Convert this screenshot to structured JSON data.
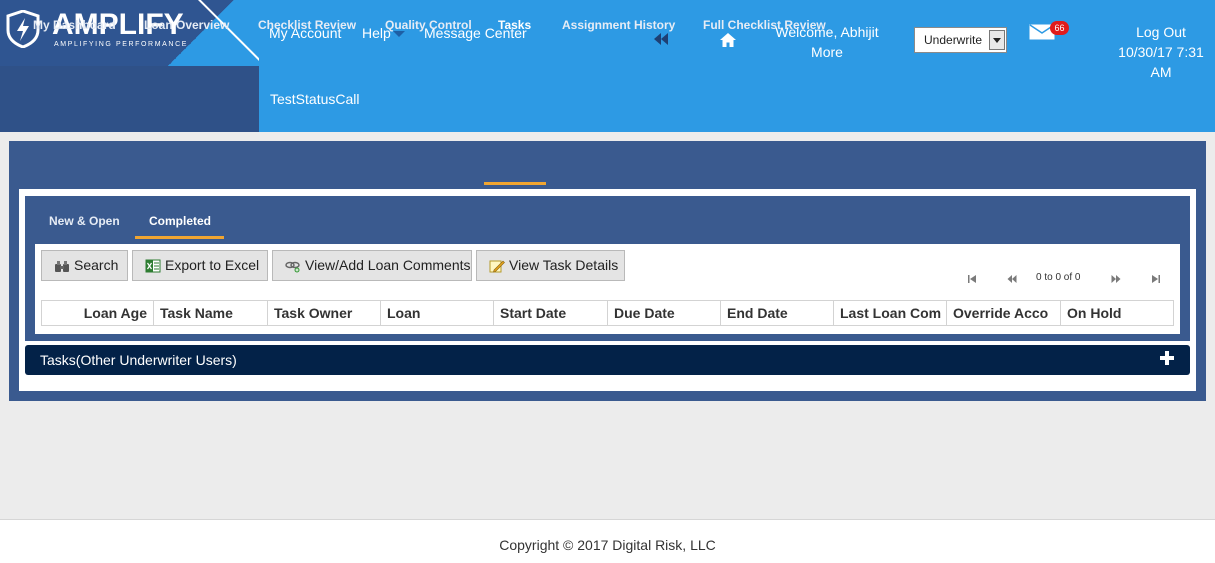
{
  "brand": {
    "name": "AMPLIFY",
    "tagline": "AMPLIFYING PERFORMANCE",
    "colors": {
      "header": "#2d9ae4",
      "logo_panel": "#2f5188",
      "content_panel": "#3a5a8f",
      "accent_underline": "#f0a531",
      "section_bar": "#032248",
      "badge": "#e11b1b"
    }
  },
  "header": {
    "links": {
      "my_account": "My Account",
      "help": "Help",
      "message_center": "Message Center",
      "status_call": "TestStatusCall"
    },
    "welcome_line1": "Welcome, Abhijit",
    "welcome_line2": "More",
    "role_select": {
      "selected": "Underwrite"
    },
    "mail_badge_count": "66",
    "logout": "Log Out",
    "datetime": "10/30/17 7:31 AM",
    "icons": [
      "shield-logo-icon",
      "caret-down-icon",
      "rewind-icon",
      "home-icon",
      "mail-icon"
    ]
  },
  "main_tabs": [
    {
      "label": "My Dashboard",
      "active": false
    },
    {
      "label": "Loan Overview",
      "active": false
    },
    {
      "label": "Checklist Review",
      "active": false
    },
    {
      "label": "Quality Control",
      "active": false
    },
    {
      "label": "Tasks",
      "active": true
    },
    {
      "label": "Assignment History",
      "active": false
    },
    {
      "label": "Full Checklist Review",
      "active": false
    }
  ],
  "sub_tabs": [
    {
      "label": "New & Open",
      "active": false
    },
    {
      "label": "Completed",
      "active": true
    }
  ],
  "toolbar": {
    "search": "Search",
    "export": "Export to Excel",
    "comments": "View/Add Loan Comments",
    "details": "View Task Details"
  },
  "pager": {
    "text": "0 to 0 of 0"
  },
  "table": {
    "columns": [
      "Loan Age",
      "Task Name",
      "Task Owner",
      "Loan",
      "Start Date",
      "Due Date",
      "End Date",
      "Last Loan Com",
      "Override Acco",
      "On Hold"
    ],
    "rows": []
  },
  "other_section": {
    "label": "Tasks(Other Underwriter Users)"
  },
  "footer": {
    "copyright": "Copyright © 2017 Digital Risk, LLC"
  }
}
